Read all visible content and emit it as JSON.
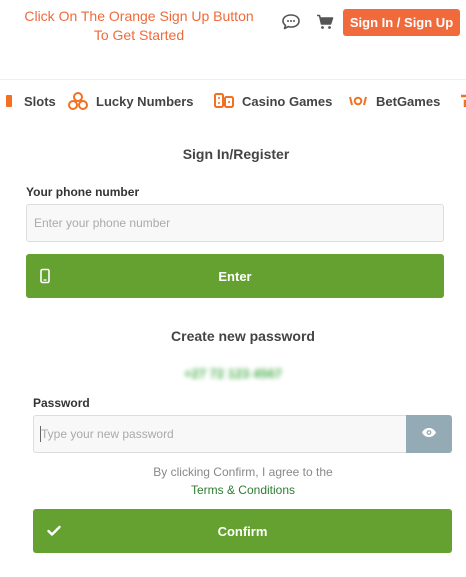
{
  "header": {
    "instruction_line1": "Click On The Orange Sign Up Button",
    "instruction_line2": "To Get Started",
    "signin_label": "Sign In / Sign Up",
    "icons": [
      "chat-icon",
      "cart-icon"
    ]
  },
  "nav": {
    "items": [
      {
        "label": "Slots",
        "icon": "slots-icon"
      },
      {
        "label": "Lucky Numbers",
        "icon": "lucky-balls-icon"
      },
      {
        "label": "Casino Games",
        "icon": "casino-dice-icon"
      },
      {
        "label": "BetGames",
        "icon": "betgames-icon"
      }
    ]
  },
  "form": {
    "title": "Sign In/Register",
    "phone_label": "Your phone number",
    "phone_placeholder": "Enter your phone number",
    "enter_label": "Enter",
    "password_title": "Create new password",
    "masked_number": "+27 72 123 4567",
    "password_label": "Password",
    "password_placeholder": "Type your new password",
    "agree_text": "By clicking Confirm, I agree to the",
    "terms_label": "Terms & Conditions",
    "confirm_label": "Confirm"
  },
  "colors": {
    "accent_orange": "#f06a3b",
    "primary_green": "#64a130",
    "eye_button": "#94abb5"
  }
}
